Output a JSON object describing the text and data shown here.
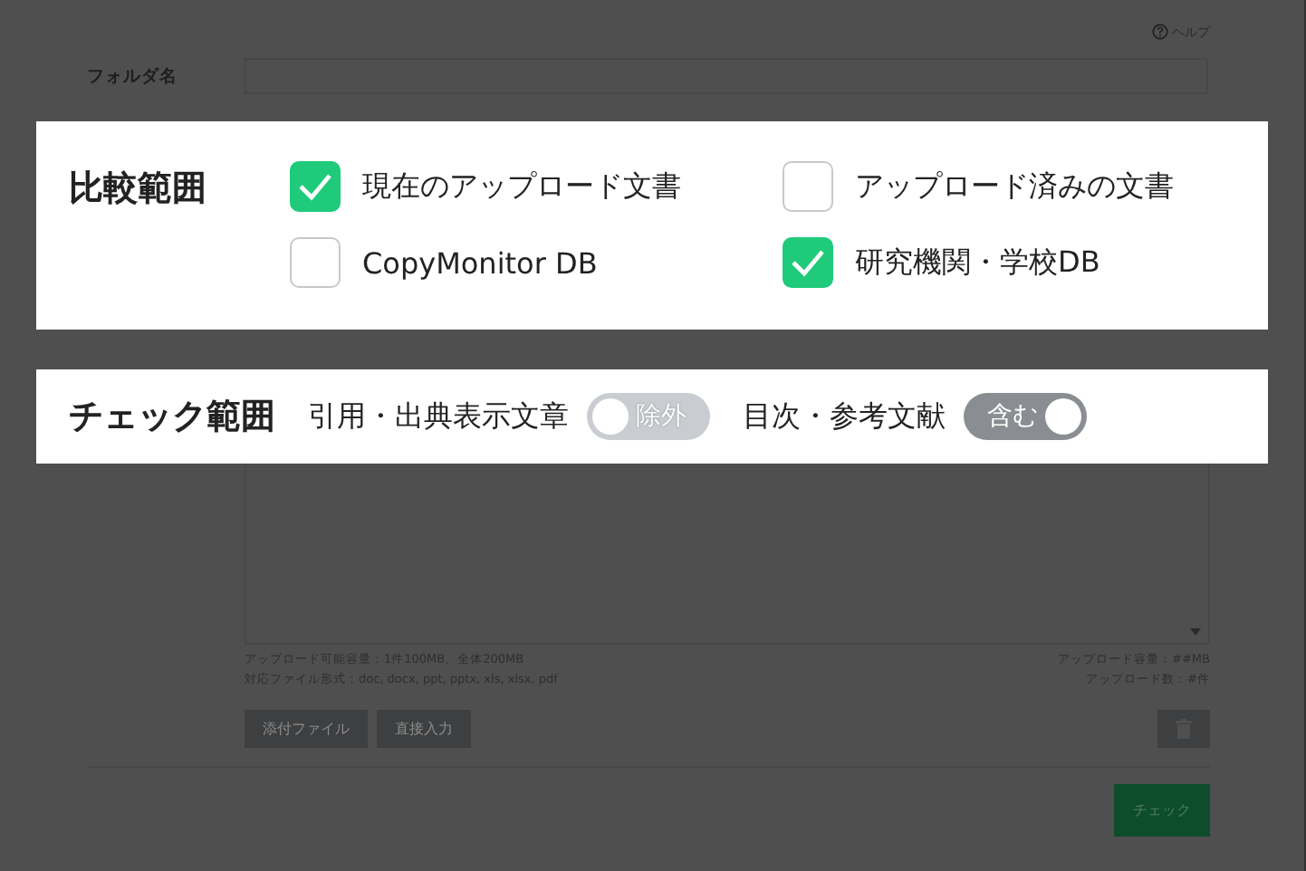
{
  "help": {
    "label": "ヘルプ"
  },
  "folder": {
    "label": "フォルダ名"
  },
  "compare": {
    "title": "比較範囲",
    "options": [
      {
        "label": "現在のアップロード文書",
        "checked": true
      },
      {
        "label": "アップロード済みの文書",
        "checked": false
      },
      {
        "label": "CopyMonitor DB",
        "checked": false
      },
      {
        "label": "研究機関・学校DB",
        "checked": true
      }
    ]
  },
  "check_range": {
    "title": "チェック範囲",
    "toggles": [
      {
        "label": "引用・出典表示文章",
        "switch_text": "除外",
        "on": false
      },
      {
        "label": "目次・参考文献",
        "switch_text": "含む",
        "on": true
      }
    ]
  },
  "upload_info": {
    "left": [
      "アップロード可能容量：1件100MB、全体200MB",
      "対応ファイル形式：doc, docx, ppt, pptx, xls, xlsx, pdf"
    ],
    "right": [
      "アップロード容量：##MB",
      "アップロード数：#件"
    ]
  },
  "buttons": [
    "添付ファイル",
    "直接入力"
  ],
  "check_button": "チェック"
}
